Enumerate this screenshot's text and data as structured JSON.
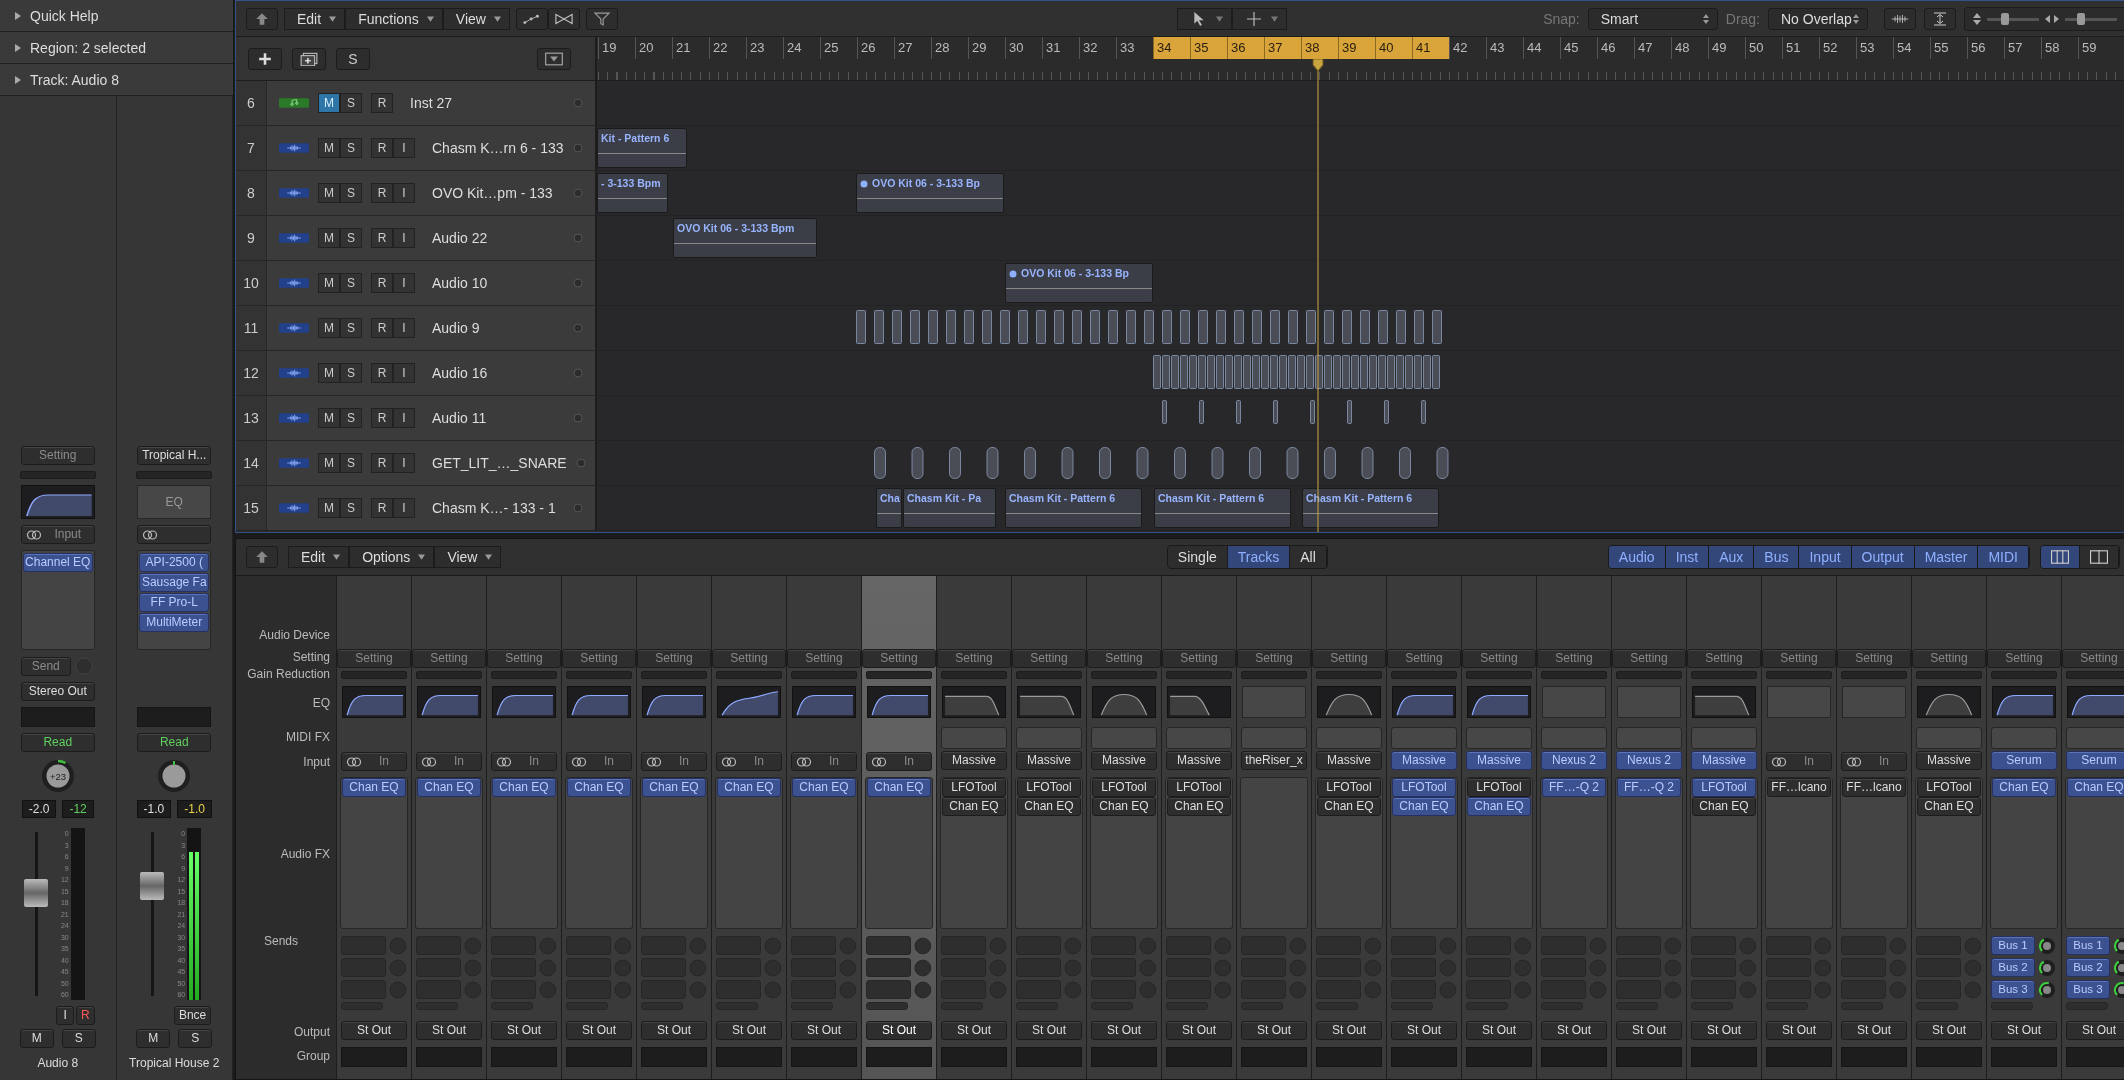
{
  "inspector": {
    "sections": [
      {
        "label": "Quick Help",
        "expanded": false
      },
      {
        "label": "Region: 2 selected",
        "expanded": false
      },
      {
        "label": "Track: Audio 8",
        "expanded": false
      }
    ],
    "strips": [
      {
        "setting": {
          "label": "Setting",
          "dim": true
        },
        "eq": {
          "kind": "highpass",
          "active": true
        },
        "input": {
          "kind": "link-label",
          "label": "Input"
        },
        "plugins": [
          {
            "label": "Channel EQ",
            "active": true
          }
        ],
        "send": "Send",
        "output": "Stereo Out",
        "automation": "Read",
        "pan": {
          "label": "+23",
          "kind": "right"
        },
        "volume": "-2.0",
        "peak": {
          "label": "-12",
          "kind": "ok"
        },
        "fader": {
          "level": 0.62
        },
        "meter_scale": [
          "0",
          "3",
          "6",
          "9",
          "12",
          "15",
          "18",
          "21",
          "24",
          "30",
          "35",
          "40",
          "45",
          "50",
          "60"
        ],
        "buttons": [
          {
            "label": "I",
            "on": false
          },
          {
            "label": "R",
            "on": true
          }
        ],
        "mute": "M",
        "solo": "S",
        "name": "Audio 8"
      },
      {
        "setting": {
          "label": "Tropical H...",
          "dim": false
        },
        "eq": {
          "kind": "none",
          "label": "EQ"
        },
        "input": {
          "kind": "link"
        },
        "plugins": [
          {
            "label": "API-2500 (",
            "active": true
          },
          {
            "label": "Sausage Fa",
            "active": true
          },
          {
            "label": "FF Pro-L",
            "active": true
          },
          {
            "label": "MultiMeter",
            "active": true
          }
        ],
        "automation": "Read",
        "pan": {
          "kind": "center"
        },
        "volume": "-1.0",
        "peak": {
          "label": "-1.0",
          "kind": "hot"
        },
        "fader": {
          "level": 0.66
        },
        "meter": {
          "level": 0.86
        },
        "meter_scale": [
          "0",
          "3",
          "6",
          "9",
          "12",
          "15",
          "18",
          "21",
          "24",
          "30",
          "35",
          "40",
          "45",
          "50",
          "60"
        ],
        "buttons": [
          {
            "label": "Bnce",
            "on": false
          }
        ],
        "mute": "M",
        "solo": "S",
        "name": "Tropical House 2"
      }
    ]
  },
  "tracks": {
    "toolbar": {
      "menus": [
        "Edit",
        "Functions",
        "View"
      ],
      "snap_label": "Snap:",
      "snap": "Smart",
      "drag_label": "Drag:",
      "drag": "No Overlap",
      "zoom_sliders": [
        {
          "level": 0.35
        },
        {
          "level": 0.3
        }
      ]
    },
    "header_tools": {
      "global_tracks": "S"
    },
    "ruler": [
      {
        "label": "19",
        "in_cycle": false
      },
      {
        "label": "20",
        "in_cycle": false
      },
      {
        "label": "21",
        "in_cycle": false
      },
      {
        "label": "22",
        "in_cycle": false
      },
      {
        "label": "23",
        "in_cycle": false
      },
      {
        "label": "24",
        "in_cycle": false
      },
      {
        "label": "25",
        "in_cycle": false
      },
      {
        "label": "26",
        "in_cycle": false
      },
      {
        "label": "27",
        "in_cycle": false
      },
      {
        "label": "28",
        "in_cycle": false
      },
      {
        "label": "29",
        "in_cycle": false
      },
      {
        "label": "30",
        "in_cycle": false
      },
      {
        "label": "31",
        "in_cycle": false
      },
      {
        "label": "32",
        "in_cycle": false
      },
      {
        "label": "33",
        "in_cycle": false
      },
      {
        "label": "34",
        "in_cycle": true
      },
      {
        "label": "35",
        "in_cycle": true
      },
      {
        "label": "36",
        "in_cycle": true
      },
      {
        "label": "37",
        "in_cycle": true
      },
      {
        "label": "38",
        "in_cycle": true
      },
      {
        "label": "39",
        "in_cycle": true
      },
      {
        "label": "40",
        "in_cycle": true
      },
      {
        "label": "41",
        "in_cycle": true
      },
      {
        "label": "42",
        "in_cycle": false
      },
      {
        "label": "43",
        "in_cycle": false
      },
      {
        "label": "44",
        "in_cycle": false
      },
      {
        "label": "45",
        "in_cycle": false
      },
      {
        "label": "46",
        "in_cycle": false
      },
      {
        "label": "47",
        "in_cycle": false
      },
      {
        "label": "48",
        "in_cycle": false
      },
      {
        "label": "49",
        "in_cycle": false
      },
      {
        "label": "50",
        "in_cycle": false
      },
      {
        "label": "51",
        "in_cycle": false
      },
      {
        "label": "52",
        "in_cycle": false
      },
      {
        "label": "53",
        "in_cycle": false
      },
      {
        "label": "54",
        "in_cycle": false
      },
      {
        "label": "55",
        "in_cycle": false
      },
      {
        "label": "56",
        "in_cycle": false
      },
      {
        "label": "57",
        "in_cycle": false
      },
      {
        "label": "58",
        "in_cycle": false
      },
      {
        "label": "59",
        "in_cycle": false
      }
    ],
    "rows": [
      {
        "number": "6",
        "kind": "instrument",
        "name": "Inst 27",
        "buttons": [
          {
            "label": "M",
            "on": true
          },
          {
            "label": "S",
            "on": false
          },
          {
            "label": "R",
            "on": false
          }
        ]
      },
      {
        "number": "7",
        "kind": "audio",
        "name": "Chasm K…rn 6 - 133",
        "buttons": [
          {
            "label": "M",
            "on": false
          },
          {
            "label": "S",
            "on": false
          },
          {
            "label": "R",
            "on": false
          },
          {
            "label": "I",
            "on": false
          }
        ],
        "regions": [
          {
            "label": "Kit - Pattern 6",
            "marked": false
          }
        ]
      },
      {
        "number": "8",
        "kind": "audio",
        "name": "OVO Kit…pm - 133",
        "buttons": [
          {
            "label": "M",
            "on": false
          },
          {
            "label": "S",
            "on": false
          },
          {
            "label": "R",
            "on": false
          },
          {
            "label": "I",
            "on": false
          }
        ],
        "regions": [
          {
            "label": "- 3-133 Bpm",
            "marked": false
          },
          {
            "label": "OVO Kit 06 - 3-133 Bp",
            "marked": true
          }
        ]
      },
      {
        "number": "9",
        "kind": "audio",
        "name": "Audio 22",
        "buttons": [
          {
            "label": "M",
            "on": false
          },
          {
            "label": "S",
            "on": false
          },
          {
            "label": "R",
            "on": false
          },
          {
            "label": "I",
            "on": false
          }
        ],
        "regions": [
          {
            "label": "OVO Kit 06 - 3-133 Bpm",
            "marked": false
          }
        ]
      },
      {
        "number": "10",
        "kind": "audio",
        "name": "Audio 10",
        "buttons": [
          {
            "label": "M",
            "on": false
          },
          {
            "label": "S",
            "on": false
          },
          {
            "label": "R",
            "on": false
          },
          {
            "label": "I",
            "on": false
          }
        ],
        "regions": [
          {
            "label": "OVO Kit 06 - 3-133 Bp",
            "marked": true
          }
        ]
      },
      {
        "number": "11",
        "kind": "audio",
        "name": "Audio 9",
        "buttons": [
          {
            "label": "M",
            "on": false
          },
          {
            "label": "S",
            "on": false
          },
          {
            "label": "R",
            "on": false
          },
          {
            "label": "I",
            "on": false
          }
        ],
        "clips": {
          "kind": "sparse"
        }
      },
      {
        "number": "12",
        "kind": "audio",
        "name": "Audio 16",
        "buttons": [
          {
            "label": "M",
            "on": false
          },
          {
            "label": "S",
            "on": false
          },
          {
            "label": "R",
            "on": false
          },
          {
            "label": "I",
            "on": false
          }
        ],
        "clips": {
          "kind": "dense"
        }
      },
      {
        "number": "13",
        "kind": "audio",
        "name": "Audio 11",
        "buttons": [
          {
            "label": "M",
            "on": false
          },
          {
            "label": "S",
            "on": false
          },
          {
            "label": "R",
            "on": false
          },
          {
            "label": "I",
            "on": false
          }
        ],
        "clips": {
          "kind": "thin"
        }
      },
      {
        "number": "14",
        "kind": "audio",
        "name": "GET_LIT_…_SNARE",
        "buttons": [
          {
            "label": "M",
            "on": false
          },
          {
            "label": "S",
            "on": false
          },
          {
            "label": "R",
            "on": false
          },
          {
            "label": "I",
            "on": false
          }
        ],
        "clips": {
          "kind": "rounded"
        }
      },
      {
        "number": "15",
        "kind": "audio",
        "name": "Chasm K…- 133 - 1",
        "buttons": [
          {
            "label": "M",
            "on": false
          },
          {
            "label": "S",
            "on": false
          },
          {
            "label": "R",
            "on": false
          },
          {
            "label": "I",
            "on": false
          }
        ],
        "regions": [
          {
            "label": "Cha",
            "marked": false
          },
          {
            "label": "Chasm Kit - Pa",
            "marked": false
          },
          {
            "label": "Chasm Kit - Pattern 6",
            "marked": false
          },
          {
            "label": "Chasm Kit - Pattern 6",
            "marked": false
          },
          {
            "label": "Chasm Kit - Pattern 6",
            "marked": false
          }
        ]
      }
    ]
  },
  "mixer": {
    "menus": [
      "Edit",
      "Options",
      "View"
    ],
    "modes": [
      {
        "label": "Single",
        "selected": false
      },
      {
        "label": "Tracks",
        "selected": true
      },
      {
        "label": "All",
        "selected": false
      }
    ],
    "filters": [
      {
        "label": "Audio",
        "selected": true
      },
      {
        "label": "Inst",
        "selected": true
      },
      {
        "label": "Aux",
        "selected": true
      },
      {
        "label": "Bus",
        "selected": true
      },
      {
        "label": "Input",
        "selected": true
      },
      {
        "label": "Output",
        "selected": true
      },
      {
        "label": "Master",
        "selected": true
      },
      {
        "label": "MIDI",
        "selected": true
      }
    ],
    "layouts": [
      {
        "kind": "wide",
        "selected": true
      },
      {
        "kind": "narrow",
        "selected": false
      }
    ],
    "row_labels": [
      "Audio Device",
      "Setting",
      "Gain Reduction",
      "EQ",
      "MIDI FX",
      "Input",
      "Audio FX",
      "Sends",
      "Output",
      "Group"
    ],
    "strips": [
      {
        "selected": false,
        "setting": "Setting",
        "eq": {
          "kind": "highpass",
          "active": true
        },
        "input": {
          "kind": "link",
          "label": "In"
        },
        "fx": [
          {
            "label": "Chan EQ",
            "active": true
          }
        ],
        "output": "St Out"
      },
      {
        "selected": false,
        "setting": "Setting",
        "eq": {
          "kind": "highpass",
          "active": true
        },
        "input": {
          "kind": "link",
          "label": "In"
        },
        "fx": [
          {
            "label": "Chan EQ",
            "active": true
          }
        ],
        "output": "St Out"
      },
      {
        "selected": false,
        "setting": "Setting",
        "eq": {
          "kind": "highpass",
          "active": true
        },
        "input": {
          "kind": "link",
          "label": "In"
        },
        "fx": [
          {
            "label": "Chan EQ",
            "active": true
          }
        ],
        "output": "St Out"
      },
      {
        "selected": false,
        "setting": "Setting",
        "eq": {
          "kind": "highpass",
          "active": true
        },
        "input": {
          "kind": "link",
          "label": "In"
        },
        "fx": [
          {
            "label": "Chan EQ",
            "active": true
          }
        ],
        "output": "St Out"
      },
      {
        "selected": false,
        "setting": "Setting",
        "eq": {
          "kind": "highpass",
          "active": true
        },
        "input": {
          "kind": "link",
          "label": "In"
        },
        "fx": [
          {
            "label": "Chan EQ",
            "active": true
          }
        ],
        "output": "St Out"
      },
      {
        "selected": false,
        "setting": "Setting",
        "eq": {
          "kind": "tilt",
          "active": true
        },
        "input": {
          "kind": "link",
          "label": "In"
        },
        "fx": [
          {
            "label": "Chan EQ",
            "active": true
          }
        ],
        "output": "St Out"
      },
      {
        "selected": false,
        "setting": "Setting",
        "eq": {
          "kind": "highpass",
          "active": true
        },
        "input": {
          "kind": "link",
          "label": "In"
        },
        "fx": [
          {
            "label": "Chan EQ",
            "active": true
          }
        ],
        "output": "St Out"
      },
      {
        "selected": true,
        "setting": "Setting",
        "eq": {
          "kind": "highpass",
          "active": true
        },
        "input": {
          "kind": "link",
          "label": "In"
        },
        "fx": [
          {
            "label": "Chan EQ",
            "active": true
          }
        ],
        "output": "St Out"
      },
      {
        "selected": false,
        "setting": "Setting",
        "eq": {
          "kind": "lowpass",
          "active": false
        },
        "input": {
          "kind": "plugin",
          "label": "Massive",
          "active": false
        },
        "fx": [
          {
            "label": "LFOTool",
            "active": false
          },
          {
            "label": "Chan EQ",
            "active": false
          }
        ],
        "output": "St Out"
      },
      {
        "selected": false,
        "setting": "Setting",
        "eq": {
          "kind": "lowpass",
          "active": false
        },
        "input": {
          "kind": "plugin",
          "label": "Massive",
          "active": false
        },
        "fx": [
          {
            "label": "LFOTool",
            "active": false
          },
          {
            "label": "Chan EQ",
            "active": false
          }
        ],
        "output": "St Out"
      },
      {
        "selected": false,
        "setting": "Setting",
        "eq": {
          "kind": "bandpass",
          "active": false
        },
        "input": {
          "kind": "plugin",
          "label": "Massive",
          "active": false
        },
        "fx": [
          {
            "label": "LFOTool",
            "active": false
          },
          {
            "label": "Chan EQ",
            "active": false
          }
        ],
        "output": "St Out"
      },
      {
        "selected": false,
        "setting": "Setting",
        "eq": {
          "kind": "lowcut",
          "active": false
        },
        "input": {
          "kind": "plugin",
          "label": "Massive",
          "active": false
        },
        "fx": [
          {
            "label": "LFOTool",
            "active": false
          },
          {
            "label": "Chan EQ",
            "active": false
          }
        ],
        "output": "St Out"
      },
      {
        "selected": false,
        "setting": "Setting",
        "eq": {
          "kind": "none"
        },
        "input": {
          "kind": "plugin",
          "label": "theRiser_x",
          "active": false
        },
        "output": "St Out"
      },
      {
        "selected": false,
        "setting": "Setting",
        "eq": {
          "kind": "bandpass",
          "active": false
        },
        "input": {
          "kind": "plugin",
          "label": "Massive",
          "active": false
        },
        "fx": [
          {
            "label": "LFOTool",
            "active": false
          },
          {
            "label": "Chan EQ",
            "active": false
          }
        ],
        "output": "St Out"
      },
      {
        "selected": false,
        "setting": "Setting",
        "eq": {
          "kind": "highpass",
          "active": true
        },
        "input": {
          "kind": "plugin",
          "label": "Massive",
          "active": true
        },
        "fx": [
          {
            "label": "LFOTool",
            "active": true
          },
          {
            "label": "Chan EQ",
            "active": true
          }
        ],
        "output": "St Out"
      },
      {
        "selected": false,
        "setting": "Setting",
        "eq": {
          "kind": "highpass",
          "active": true
        },
        "input": {
          "kind": "plugin",
          "label": "Massive",
          "active": true
        },
        "fx": [
          {
            "label": "LFOTool",
            "active": false
          },
          {
            "label": "Chan EQ",
            "active": true
          }
        ],
        "output": "St Out"
      },
      {
        "selected": false,
        "setting": "Setting",
        "eq": {
          "kind": "none"
        },
        "input": {
          "kind": "plugin",
          "label": "Nexus 2",
          "active": true
        },
        "fx": [
          {
            "label": "FF…-Q 2",
            "active": true
          }
        ],
        "output": "St Out"
      },
      {
        "selected": false,
        "setting": "Setting",
        "eq": {
          "kind": "none"
        },
        "input": {
          "kind": "plugin",
          "label": "Nexus 2",
          "active": true
        },
        "fx": [
          {
            "label": "FF…-Q 2",
            "active": true
          }
        ],
        "output": "St Out"
      },
      {
        "selected": false,
        "setting": "Setting",
        "eq": {
          "kind": "lowpass",
          "active": false
        },
        "input": {
          "kind": "plugin",
          "label": "Massive",
          "active": true
        },
        "fx": [
          {
            "label": "LFOTool",
            "active": true
          },
          {
            "label": "Chan EQ",
            "active": false
          }
        ],
        "output": "St Out"
      },
      {
        "selected": false,
        "setting": "Setting",
        "eq": {
          "kind": "none"
        },
        "input": {
          "kind": "link",
          "label": "In"
        },
        "fx": [
          {
            "label": "FF…lcano",
            "active": false
          }
        ],
        "output": "St Out"
      },
      {
        "selected": false,
        "setting": "Setting",
        "eq": {
          "kind": "none"
        },
        "input": {
          "kind": "link",
          "label": "In"
        },
        "fx": [
          {
            "label": "FF…lcano",
            "active": false
          }
        ],
        "output": "St Out"
      },
      {
        "selected": false,
        "setting": "Setting",
        "eq": {
          "kind": "bandpass",
          "active": false
        },
        "input": {
          "kind": "plugin",
          "label": "Massive",
          "active": false
        },
        "fx": [
          {
            "label": "LFOTool",
            "active": false
          },
          {
            "label": "Chan EQ",
            "active": false
          }
        ],
        "output": "St Out"
      },
      {
        "selected": false,
        "setting": "Setting",
        "eq": {
          "kind": "highpass",
          "active": true
        },
        "input": {
          "kind": "plugin",
          "label": "Serum",
          "active": true
        },
        "fx": [
          {
            "label": "Chan EQ",
            "active": true
          }
        ],
        "sends": [
          {
            "label": "Bus 1",
            "kind": "low"
          },
          {
            "label": "Bus 2",
            "kind": "low"
          },
          {
            "label": "Bus 3",
            "kind": "mid"
          }
        ],
        "output": "St Out"
      },
      {
        "selected": false,
        "setting": "Setting",
        "eq": {
          "kind": "highpass",
          "active": true
        },
        "input": {
          "kind": "plugin",
          "label": "Serum",
          "active": true
        },
        "fx": [
          {
            "label": "Chan EQ",
            "active": true
          }
        ],
        "sends": [
          {
            "label": "Bus 1",
            "kind": "low"
          },
          {
            "label": "Bus 2",
            "kind": "low"
          },
          {
            "label": "Bus 3",
            "kind": "mid"
          }
        ],
        "output": "St Out"
      }
    ]
  }
}
